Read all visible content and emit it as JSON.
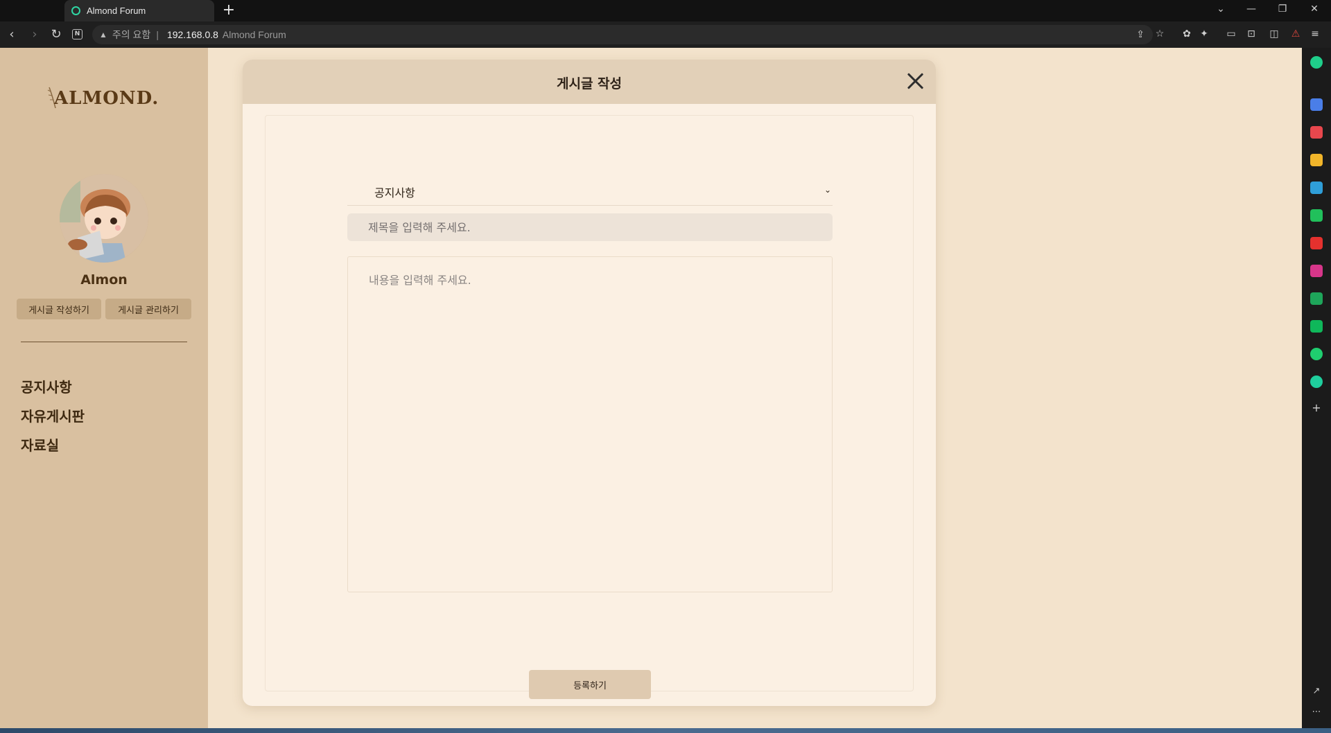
{
  "browser": {
    "tab_title": "Almond Forum",
    "new_tab": "+",
    "address": {
      "warning_text": "주의 요함",
      "separator": "|",
      "host": "192.168.0.8",
      "page_title": "Almond Forum"
    },
    "window_controls": [
      "⌄",
      "—",
      "❐",
      "✕"
    ]
  },
  "sidebar": {
    "brand": "ALMOND.",
    "user_name": "Almon",
    "buttons": {
      "write": "게시글 작성하기",
      "manage": "게시글 관리하기"
    },
    "nav": [
      {
        "label": "공지사항"
      },
      {
        "label": "자유게시판"
      },
      {
        "label": "자료실"
      }
    ]
  },
  "modal": {
    "title": "게시글 작성",
    "category_selected": "공지사항",
    "title_placeholder": "제목을 입력해 주세요.",
    "content_placeholder": "내용을 입력해 주세요.",
    "submit_label": "등록하기"
  },
  "colors": {
    "page_bg": "#f3e3cc",
    "sidebar_bg": "#d9c0a0",
    "modal_bg": "#fbf0e3",
    "modal_header_bg": "#e2d0b8",
    "brand_text": "#5a3a17"
  },
  "side_panel_icons": [
    "whale-icon",
    "mail-icon",
    "pocket-icon",
    "bookmark-star-icon",
    "edge-icon",
    "chat-icon",
    "youtube-icon",
    "instagram-icon",
    "chart-icon",
    "line-icon",
    "play-icon",
    "media-icon",
    "add-icon"
  ]
}
